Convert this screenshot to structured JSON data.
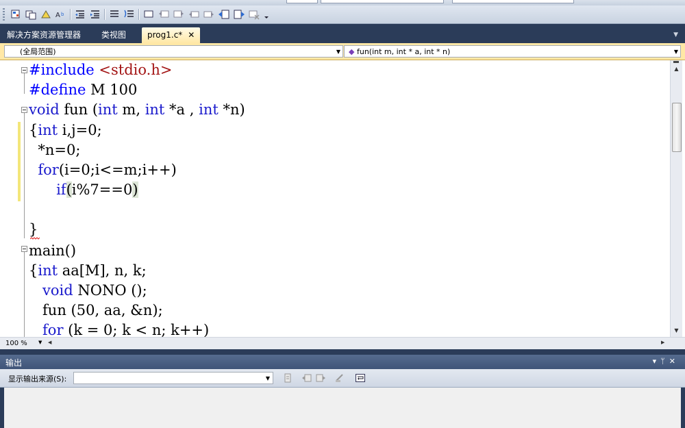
{
  "tabs": [
    {
      "label": "解决方案资源管理器",
      "active": false
    },
    {
      "label": "类视图",
      "active": false
    },
    {
      "label": "prog1.c*",
      "active": true,
      "close": "✕"
    }
  ],
  "scope": {
    "left": "(全局范围)",
    "right": "fun(int m, int * a, int * n)"
  },
  "code_lines": [
    "#include <stdio.h>",
    "#define M 100",
    "void fun (int m, int *a , int *n)",
    "{int i,j=0;",
    "  *n=0;",
    "  for(i=0;i<=m;i++)",
    "      if(i%7==0)",
    "",
    "}",
    "main()",
    "{int aa[M], n, k;",
    "   void NONO ();",
    "   fun (50, aa, &n);",
    "   for (k = 0; k < n; k++)"
  ],
  "zoom": "100 %",
  "output": {
    "title": "输出",
    "source_label": "显示输出来源(S):",
    "source_value": ""
  },
  "colors": {
    "keyword": "#1a1acc",
    "string": "#a31515",
    "accent_tab": "#ffe8a6",
    "chrome": "#2b3c59"
  }
}
